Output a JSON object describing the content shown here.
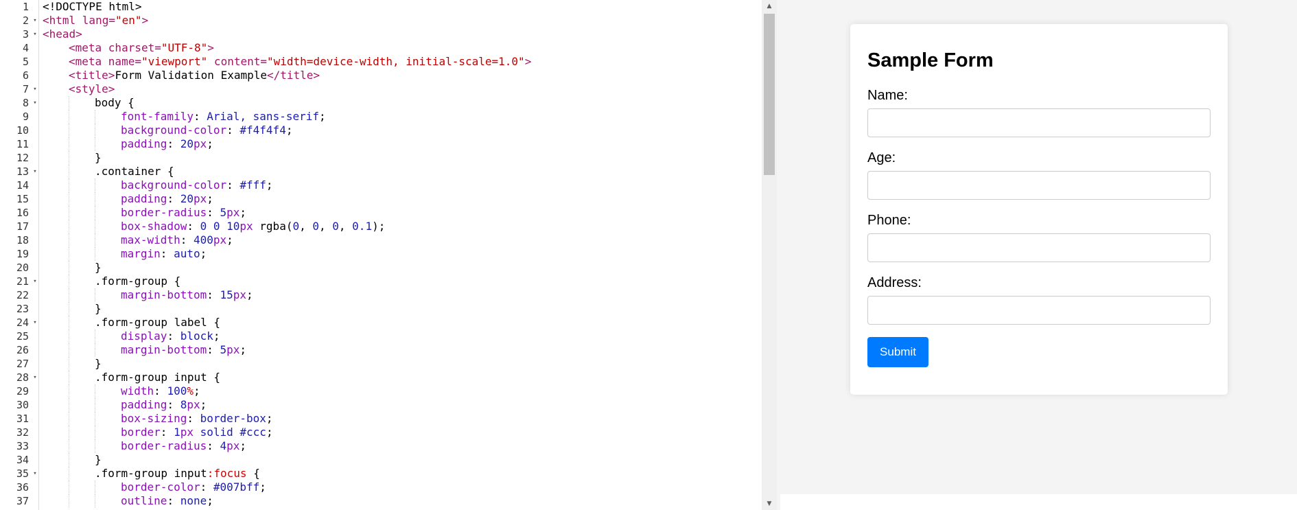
{
  "editor": {
    "lines": [
      {
        "n": "1",
        "fold": false,
        "indent": 0,
        "tokens": [
          [
            "t-dt",
            "<!DOCTYPE html>"
          ]
        ]
      },
      {
        "n": "2",
        "fold": true,
        "indent": 0,
        "tokens": [
          [
            "t-tag",
            "<html "
          ],
          [
            "t-attr",
            "lang="
          ],
          [
            "t-str",
            "\"en\""
          ],
          [
            "t-tag",
            ">"
          ]
        ]
      },
      {
        "n": "3",
        "fold": true,
        "indent": 0,
        "tokens": [
          [
            "t-tag",
            "<head>"
          ]
        ]
      },
      {
        "n": "4",
        "fold": false,
        "indent": 1,
        "tokens": [
          [
            "t-tag",
            "<meta "
          ],
          [
            "t-attr",
            "charset="
          ],
          [
            "t-str",
            "\"UTF-8\""
          ],
          [
            "t-tag",
            ">"
          ]
        ]
      },
      {
        "n": "5",
        "fold": false,
        "indent": 1,
        "tokens": [
          [
            "t-tag",
            "<meta "
          ],
          [
            "t-attr",
            "name="
          ],
          [
            "t-str",
            "\"viewport\""
          ],
          [
            "t-attr",
            " content="
          ],
          [
            "t-str",
            "\"width=device-width, initial-scale=1.0\""
          ],
          [
            "t-tag",
            ">"
          ]
        ]
      },
      {
        "n": "6",
        "fold": false,
        "indent": 1,
        "tokens": [
          [
            "t-tag",
            "<title>"
          ],
          [
            "t-txt",
            "Form Validation Example"
          ],
          [
            "t-tag",
            "</title>"
          ]
        ]
      },
      {
        "n": "7",
        "fold": true,
        "indent": 1,
        "tokens": [
          [
            "t-tag",
            "<style>"
          ]
        ]
      },
      {
        "n": "8",
        "fold": true,
        "indent": 2,
        "tokens": [
          [
            "t-sel",
            "body {"
          ]
        ]
      },
      {
        "n": "9",
        "fold": false,
        "indent": 3,
        "tokens": [
          [
            "t-prop",
            "font-family"
          ],
          [
            "t-sel",
            ": "
          ],
          [
            "t-val",
            "Arial, sans-serif"
          ],
          [
            "t-sel",
            ";"
          ]
        ]
      },
      {
        "n": "10",
        "fold": false,
        "indent": 3,
        "tokens": [
          [
            "t-prop",
            "background-color"
          ],
          [
            "t-sel",
            ": "
          ],
          [
            "t-val",
            "#f4f4f4"
          ],
          [
            "t-sel",
            ";"
          ]
        ]
      },
      {
        "n": "11",
        "fold": false,
        "indent": 3,
        "tokens": [
          [
            "t-prop",
            "padding"
          ],
          [
            "t-sel",
            ": "
          ],
          [
            "t-num",
            "20"
          ],
          [
            "t-prop",
            "px"
          ],
          [
            "t-sel",
            ";"
          ]
        ]
      },
      {
        "n": "12",
        "fold": false,
        "indent": 2,
        "tokens": [
          [
            "t-sel",
            "}"
          ]
        ]
      },
      {
        "n": "13",
        "fold": true,
        "indent": 2,
        "tokens": [
          [
            "t-sel",
            ".container {"
          ]
        ]
      },
      {
        "n": "14",
        "fold": false,
        "indent": 3,
        "tokens": [
          [
            "t-prop",
            "background-color"
          ],
          [
            "t-sel",
            ": "
          ],
          [
            "t-val",
            "#fff"
          ],
          [
            "t-sel",
            ";"
          ]
        ]
      },
      {
        "n": "15",
        "fold": false,
        "indent": 3,
        "tokens": [
          [
            "t-prop",
            "padding"
          ],
          [
            "t-sel",
            ": "
          ],
          [
            "t-num",
            "20"
          ],
          [
            "t-prop",
            "px"
          ],
          [
            "t-sel",
            ";"
          ]
        ]
      },
      {
        "n": "16",
        "fold": false,
        "indent": 3,
        "tokens": [
          [
            "t-prop",
            "border-radius"
          ],
          [
            "t-sel",
            ": "
          ],
          [
            "t-num",
            "5"
          ],
          [
            "t-prop",
            "px"
          ],
          [
            "t-sel",
            ";"
          ]
        ]
      },
      {
        "n": "17",
        "fold": false,
        "indent": 3,
        "tokens": [
          [
            "t-prop",
            "box-shadow"
          ],
          [
            "t-sel",
            ": "
          ],
          [
            "t-num",
            "0 0 10"
          ],
          [
            "t-prop",
            "px"
          ],
          [
            "t-sel",
            " rgba("
          ],
          [
            "t-num",
            "0"
          ],
          [
            "t-sel",
            ", "
          ],
          [
            "t-num",
            "0"
          ],
          [
            "t-sel",
            ", "
          ],
          [
            "t-num",
            "0"
          ],
          [
            "t-sel",
            ", "
          ],
          [
            "t-num",
            "0.1"
          ],
          [
            "t-sel",
            ");"
          ]
        ]
      },
      {
        "n": "18",
        "fold": false,
        "indent": 3,
        "tokens": [
          [
            "t-prop",
            "max-width"
          ],
          [
            "t-sel",
            ": "
          ],
          [
            "t-num",
            "400"
          ],
          [
            "t-prop",
            "px"
          ],
          [
            "t-sel",
            ";"
          ]
        ]
      },
      {
        "n": "19",
        "fold": false,
        "indent": 3,
        "tokens": [
          [
            "t-prop",
            "margin"
          ],
          [
            "t-sel",
            ": "
          ],
          [
            "t-val",
            "auto"
          ],
          [
            "t-sel",
            ";"
          ]
        ]
      },
      {
        "n": "20",
        "fold": false,
        "indent": 2,
        "tokens": [
          [
            "t-sel",
            "}"
          ]
        ]
      },
      {
        "n": "21",
        "fold": true,
        "indent": 2,
        "tokens": [
          [
            "t-sel",
            ".form-group {"
          ]
        ]
      },
      {
        "n": "22",
        "fold": false,
        "indent": 3,
        "tokens": [
          [
            "t-prop",
            "margin-bottom"
          ],
          [
            "t-sel",
            ": "
          ],
          [
            "t-num",
            "15"
          ],
          [
            "t-prop",
            "px"
          ],
          [
            "t-sel",
            ";"
          ]
        ]
      },
      {
        "n": "23",
        "fold": false,
        "indent": 2,
        "tokens": [
          [
            "t-sel",
            "}"
          ]
        ]
      },
      {
        "n": "24",
        "fold": true,
        "indent": 2,
        "tokens": [
          [
            "t-sel",
            ".form-group label {"
          ]
        ]
      },
      {
        "n": "25",
        "fold": false,
        "indent": 3,
        "tokens": [
          [
            "t-prop",
            "display"
          ],
          [
            "t-sel",
            ": "
          ],
          [
            "t-val",
            "block"
          ],
          [
            "t-sel",
            ";"
          ]
        ]
      },
      {
        "n": "26",
        "fold": false,
        "indent": 3,
        "tokens": [
          [
            "t-prop",
            "margin-bottom"
          ],
          [
            "t-sel",
            ": "
          ],
          [
            "t-num",
            "5"
          ],
          [
            "t-prop",
            "px"
          ],
          [
            "t-sel",
            ";"
          ]
        ]
      },
      {
        "n": "27",
        "fold": false,
        "indent": 2,
        "tokens": [
          [
            "t-sel",
            "}"
          ]
        ]
      },
      {
        "n": "28",
        "fold": true,
        "indent": 2,
        "tokens": [
          [
            "t-sel",
            ".form-group input {"
          ]
        ]
      },
      {
        "n": "29",
        "fold": false,
        "indent": 3,
        "tokens": [
          [
            "t-prop",
            "width"
          ],
          [
            "t-sel",
            ": "
          ],
          [
            "t-num",
            "100"
          ],
          [
            "t-kw",
            "%"
          ],
          [
            "t-sel",
            ";"
          ]
        ]
      },
      {
        "n": "30",
        "fold": false,
        "indent": 3,
        "tokens": [
          [
            "t-prop",
            "padding"
          ],
          [
            "t-sel",
            ": "
          ],
          [
            "t-num",
            "8"
          ],
          [
            "t-prop",
            "px"
          ],
          [
            "t-sel",
            ";"
          ]
        ]
      },
      {
        "n": "31",
        "fold": false,
        "indent": 3,
        "tokens": [
          [
            "t-prop",
            "box-sizing"
          ],
          [
            "t-sel",
            ": "
          ],
          [
            "t-val",
            "border-box"
          ],
          [
            "t-sel",
            ";"
          ]
        ]
      },
      {
        "n": "32",
        "fold": false,
        "indent": 3,
        "tokens": [
          [
            "t-prop",
            "border"
          ],
          [
            "t-sel",
            ": "
          ],
          [
            "t-num",
            "1"
          ],
          [
            "t-prop",
            "px"
          ],
          [
            "t-val",
            " solid #ccc"
          ],
          [
            "t-sel",
            ";"
          ]
        ]
      },
      {
        "n": "33",
        "fold": false,
        "indent": 3,
        "tokens": [
          [
            "t-prop",
            "border-radius"
          ],
          [
            "t-sel",
            ": "
          ],
          [
            "t-num",
            "4"
          ],
          [
            "t-prop",
            "px"
          ],
          [
            "t-sel",
            ";"
          ]
        ]
      },
      {
        "n": "34",
        "fold": false,
        "indent": 2,
        "tokens": [
          [
            "t-sel",
            "}"
          ]
        ]
      },
      {
        "n": "35",
        "fold": true,
        "indent": 2,
        "tokens": [
          [
            "t-sel",
            ".form-group input"
          ],
          [
            "t-kw",
            ":focus"
          ],
          [
            "t-sel",
            " {"
          ]
        ]
      },
      {
        "n": "36",
        "fold": false,
        "indent": 3,
        "tokens": [
          [
            "t-prop",
            "border-color"
          ],
          [
            "t-sel",
            ": "
          ],
          [
            "t-val",
            "#007bff"
          ],
          [
            "t-sel",
            ";"
          ]
        ]
      },
      {
        "n": "37",
        "fold": false,
        "indent": 3,
        "tokens": [
          [
            "t-prop",
            "outline"
          ],
          [
            "t-sel",
            ": "
          ],
          [
            "t-val",
            "none"
          ],
          [
            "t-sel",
            ";"
          ]
        ]
      }
    ]
  },
  "scrollbar": {
    "up_icon": "scroll-up-arrow-icon",
    "down_icon": "scroll-down-arrow-icon"
  },
  "preview": {
    "title": "Sample Form",
    "fields": [
      {
        "label": "Name:",
        "value": ""
      },
      {
        "label": "Age:",
        "value": ""
      },
      {
        "label": "Phone:",
        "value": ""
      },
      {
        "label": "Address:",
        "value": ""
      }
    ],
    "submit_label": "Submit"
  },
  "colors": {
    "accent": "#007bff",
    "preview_bg": "#f4f4f4",
    "tag": "#a31567",
    "string": "#c00000",
    "property": "#8a0fb8",
    "number": "#1b1bb0"
  }
}
